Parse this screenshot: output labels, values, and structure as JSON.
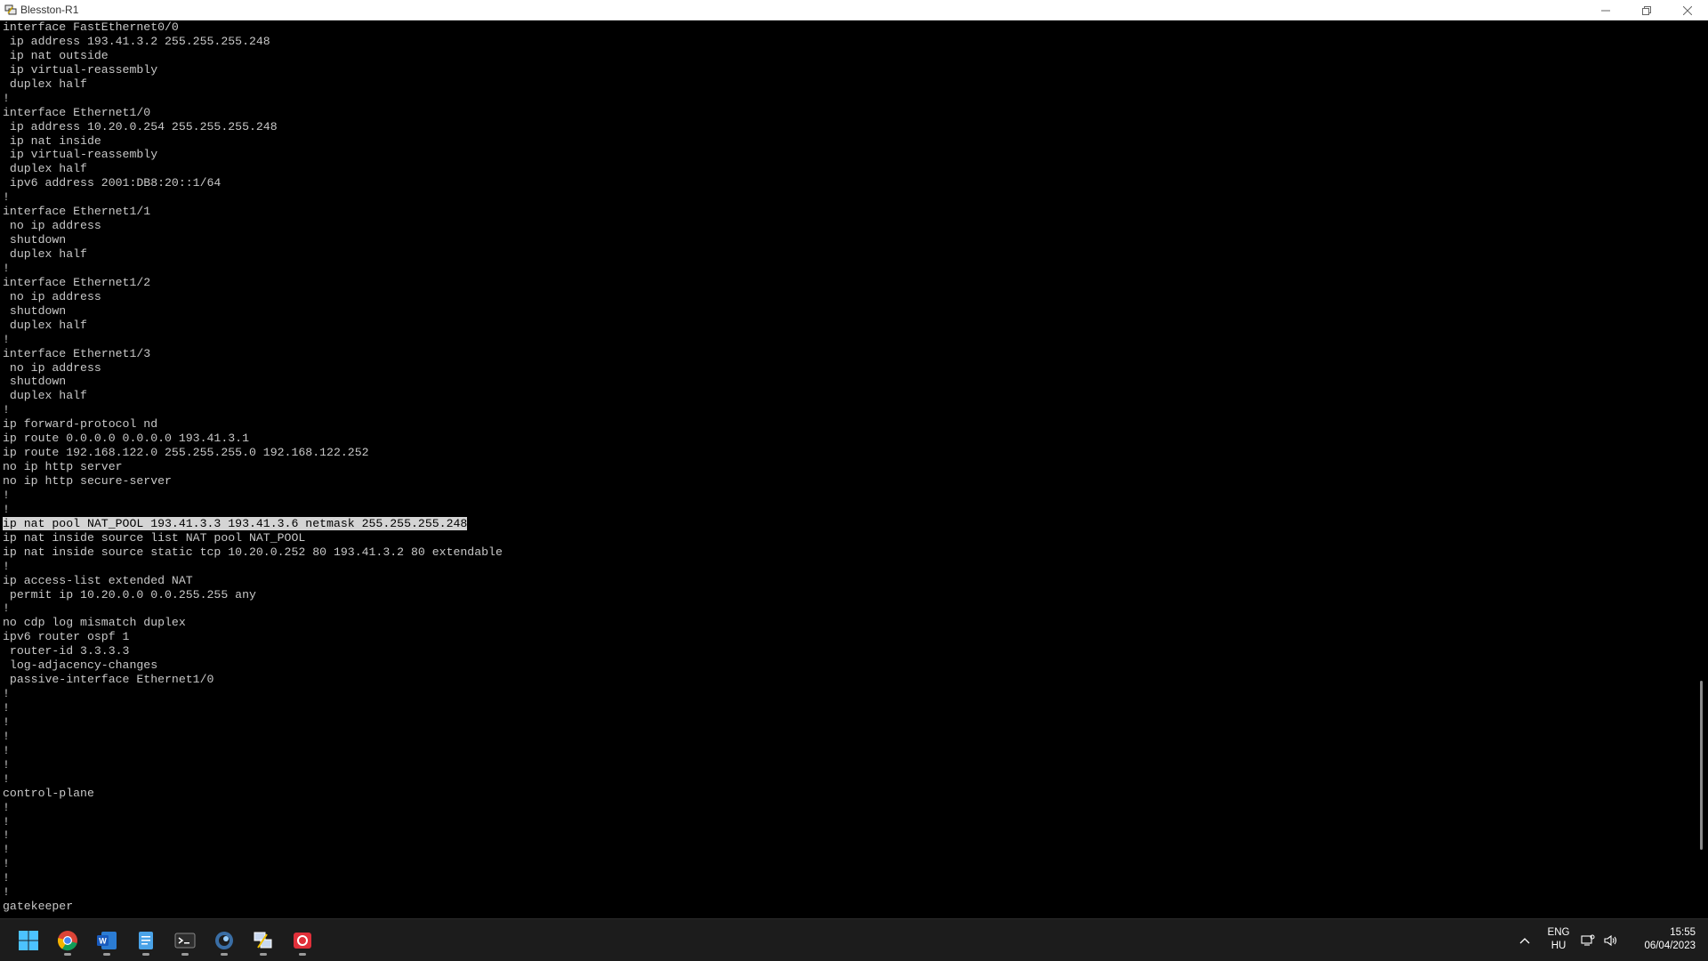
{
  "window": {
    "title": "Blesston-R1"
  },
  "terminal": {
    "lines": [
      "interface FastEthernet0/0",
      " ip address 193.41.3.2 255.255.255.248",
      " ip nat outside",
      " ip virtual-reassembly",
      " duplex half",
      "!",
      "interface Ethernet1/0",
      " ip address 10.20.0.254 255.255.255.248",
      " ip nat inside",
      " ip virtual-reassembly",
      " duplex half",
      " ipv6 address 2001:DB8:20::1/64",
      "!",
      "interface Ethernet1/1",
      " no ip address",
      " shutdown",
      " duplex half",
      "!",
      "interface Ethernet1/2",
      " no ip address",
      " shutdown",
      " duplex half",
      "!",
      "interface Ethernet1/3",
      " no ip address",
      " shutdown",
      " duplex half",
      "!",
      "ip forward-protocol nd",
      "ip route 0.0.0.0 0.0.0.0 193.41.3.1",
      "ip route 192.168.122.0 255.255.255.0 192.168.122.252",
      "no ip http server",
      "no ip http secure-server",
      "!",
      "!",
      "ip nat pool NAT_POOL 193.41.3.3 193.41.3.6 netmask 255.255.255.248",
      "ip nat inside source list NAT pool NAT_POOL",
      "ip nat inside source static tcp 10.20.0.252 80 193.41.3.2 80 extendable",
      "!",
      "ip access-list extended NAT",
      " permit ip 10.20.0.0 0.0.255.255 any",
      "!",
      "no cdp log mismatch duplex",
      "ipv6 router ospf 1",
      " router-id 3.3.3.3",
      " log-adjacency-changes",
      " passive-interface Ethernet1/0",
      "!",
      "!",
      "!",
      "!",
      "!",
      "!",
      "!",
      "control-plane",
      "!",
      "!",
      "!",
      "!",
      "!",
      "!",
      "!",
      "gatekeeper"
    ],
    "selected_line": 35
  },
  "taskbar": {
    "apps": [
      {
        "name": "start-button",
        "icon": "windows-logo"
      },
      {
        "name": "chrome",
        "icon": "chrome-icon"
      },
      {
        "name": "word",
        "icon": "word-icon"
      },
      {
        "name": "notepad",
        "icon": "notepad-icon"
      },
      {
        "name": "terminal",
        "icon": "terminal-icon"
      },
      {
        "name": "app-blue-circle",
        "icon": "circle-app-icon"
      },
      {
        "name": "putty",
        "icon": "putty-icon"
      },
      {
        "name": "app-red",
        "icon": "red-app-icon"
      }
    ],
    "lang_top": "ENG",
    "lang_bottom": "HU",
    "time": "15:55",
    "date": "06/04/2023"
  }
}
